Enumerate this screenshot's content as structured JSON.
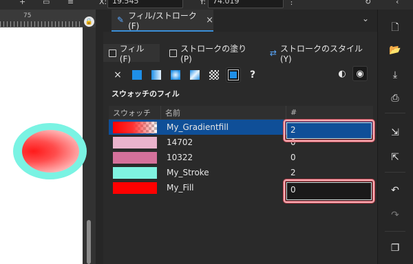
{
  "topbar": {
    "x_value": "19.545",
    "y_value": "74.019"
  },
  "ruler": {
    "mark": "75"
  },
  "panel": {
    "tab_label": "フィル/ストローク(F)",
    "tab_close": "×",
    "subtabs": [
      {
        "label": "フィル(F)"
      },
      {
        "label": "ストロークの塗り(P)"
      },
      {
        "label": "ストロークのスタイル(Y)"
      }
    ],
    "tools": {
      "none": "×",
      "unset": "?"
    },
    "section_title": "スウォッチのフィル",
    "columns": {
      "swatch": "スウォッチ",
      "name": "名前",
      "count": "#"
    },
    "rows": [
      {
        "name": "My_Gradientfill",
        "count": "2",
        "swatch_color": "gradient",
        "selected": true
      },
      {
        "name": "14702",
        "count": "0",
        "swatch_color": "#eab3cc"
      },
      {
        "name": "10322",
        "count": "0",
        "swatch_color": "#d5719b"
      },
      {
        "name": "My_Stroke",
        "count": "2",
        "swatch_color": "#7ff3e1"
      },
      {
        "name": "My_Fill",
        "count": "0",
        "swatch_color": "#ff0000"
      }
    ]
  },
  "colors": {
    "accent": "#3a8fd8",
    "selection": "#0f4f98",
    "highlight": "#f3b2b8"
  },
  "icons": {
    "collapse": "chevron-down-icon",
    "rightbar": [
      "new-document-icon",
      "open-icon",
      "save-icon",
      "print-icon",
      "import-icon",
      "export-icon",
      "undo-icon",
      "redo-icon",
      "copy-icon"
    ]
  }
}
